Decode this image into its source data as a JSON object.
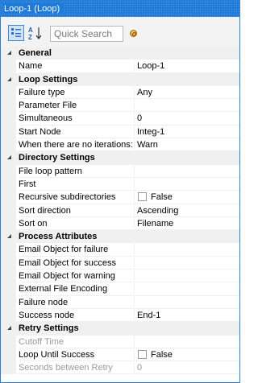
{
  "window": {
    "title": "Loop-1 (Loop)"
  },
  "toolbar": {
    "search_placeholder": "Quick Search"
  },
  "sections": [
    {
      "title": "General",
      "rows": [
        {
          "name": "Name",
          "value": "Loop-1",
          "coin": true
        }
      ]
    },
    {
      "title": "Loop Settings",
      "rows": [
        {
          "name": "Failure type",
          "value": "Any"
        },
        {
          "name": "Parameter File",
          "value": ""
        },
        {
          "name": "Simultaneous",
          "value": "0"
        },
        {
          "name": "Start Node",
          "value": "Integ-1",
          "coin": true
        },
        {
          "name": "When there are no iterations:",
          "value": "Warn"
        }
      ]
    },
    {
      "title": "Directory Settings",
      "rows": [
        {
          "name": "File loop pattern",
          "value": ""
        },
        {
          "name": "First",
          "value": ""
        },
        {
          "name": "Recursive subdirectories",
          "value": "False",
          "checkbox": true
        },
        {
          "name": "Sort direction",
          "value": "Ascending"
        },
        {
          "name": "Sort on",
          "value": "Filename"
        }
      ]
    },
    {
      "title": "Process Attributes",
      "rows": [
        {
          "name": "Email Object for failure",
          "value": ""
        },
        {
          "name": "Email Object for success",
          "value": ""
        },
        {
          "name": "Email Object for warning",
          "value": ""
        },
        {
          "name": "External File Encoding",
          "value": ""
        },
        {
          "name": "Failure node",
          "value": ""
        },
        {
          "name": "Success node",
          "value": "End-1"
        }
      ]
    },
    {
      "title": "Retry Settings",
      "rows": [
        {
          "name": "Cutoff Time",
          "value": "",
          "disabled": true
        },
        {
          "name": "Loop Until Success",
          "value": "False",
          "checkbox": true
        },
        {
          "name": "Seconds between Retry",
          "value": "0",
          "disabled": true
        }
      ]
    }
  ]
}
